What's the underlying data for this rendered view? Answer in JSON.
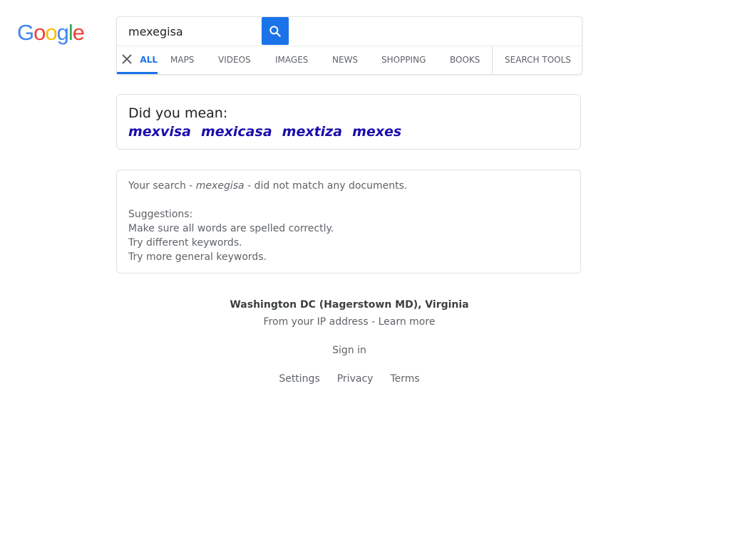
{
  "logo": {
    "letters": [
      {
        "ch": "G",
        "color": "#4285f4"
      },
      {
        "ch": "o",
        "color": "#ea4335"
      },
      {
        "ch": "o",
        "color": "#fbbc05"
      },
      {
        "ch": "g",
        "color": "#4285f4"
      },
      {
        "ch": "l",
        "color": "#34a853"
      },
      {
        "ch": "e",
        "color": "#ea4335"
      }
    ]
  },
  "search": {
    "query": "mexegisa",
    "button_icon": "search-icon",
    "clear_icon": "close-icon"
  },
  "tabs": [
    {
      "label": "ALL",
      "active": true
    },
    {
      "label": "MAPS"
    },
    {
      "label": "VIDEOS"
    },
    {
      "label": "IMAGES"
    },
    {
      "label": "NEWS"
    },
    {
      "label": "SHOPPING"
    },
    {
      "label": "BOOKS"
    }
  ],
  "search_tools_label": "SEARCH TOOLS",
  "did_you_mean": {
    "title": "Did you mean:",
    "suggestions": [
      "mexvisa",
      "mexicasa",
      "mextiza",
      "mexes"
    ]
  },
  "no_match": {
    "prefix": "Your search - ",
    "query": "mexegisa",
    "suffix": " - did not match any documents.",
    "suggestions_title": "Suggestions:",
    "tips": [
      "Make sure all words are spelled correctly.",
      "Try different keywords.",
      "Try more general keywords."
    ]
  },
  "location": {
    "name": "Washington DC (Hagerstown MD), Virginia",
    "source_prefix": "From your IP address - ",
    "learn_more": "Learn more"
  },
  "footer": {
    "sign_in": "Sign in",
    "links": [
      "Settings",
      "Privacy",
      "Terms"
    ]
  },
  "colors": {
    "accent": "#1a73e8",
    "link": "#1a0dab"
  }
}
